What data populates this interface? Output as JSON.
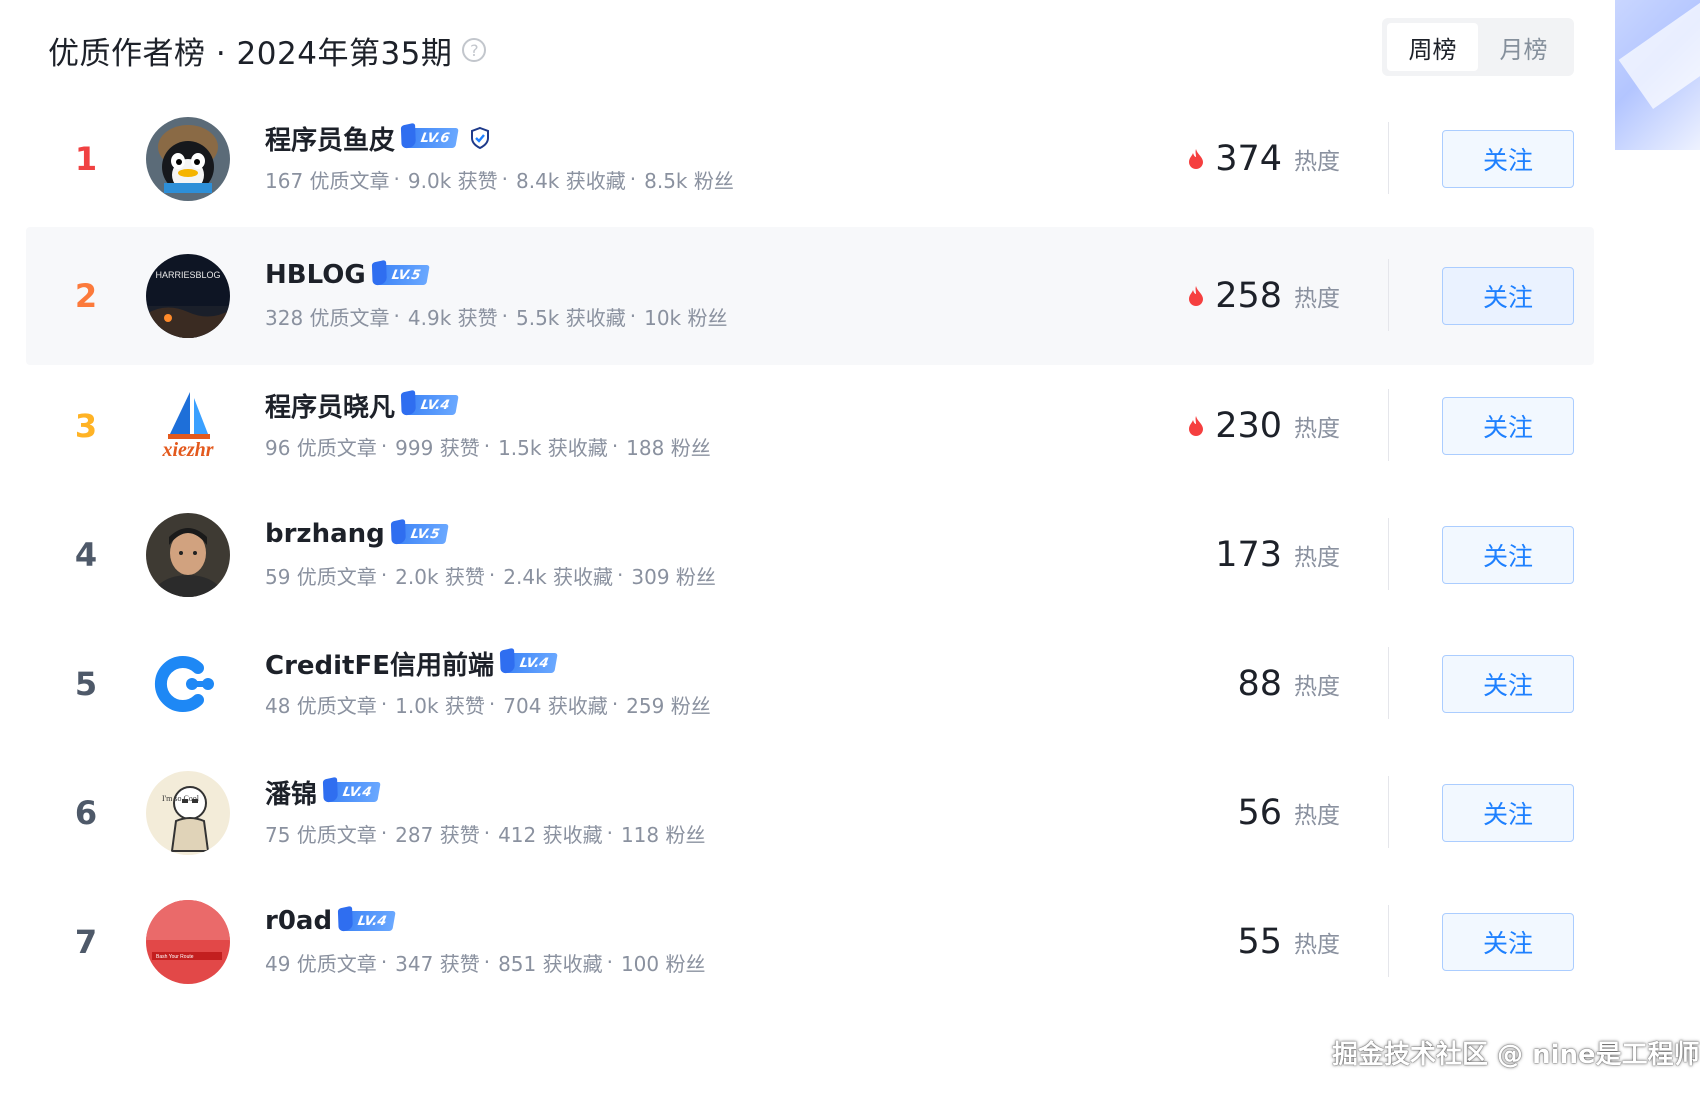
{
  "header": {
    "title": "优质作者榜 · 2024年第35期",
    "help_icon": "question-circle-icon",
    "tabs": [
      {
        "label": "周榜",
        "active": true
      },
      {
        "label": "月榜",
        "active": false
      }
    ]
  },
  "colors": {
    "rank1": "#f04142",
    "rank2": "#fc7a3b",
    "rank3": "#ffb325",
    "rank_other": "#4e5969",
    "accent": "#1e80ff",
    "flame": "#f53f3f"
  },
  "authors": [
    {
      "rank": "1",
      "name": "程序员鱼皮",
      "level": "LV.6",
      "verified": true,
      "stats": {
        "articles": "167 优质文章",
        "likes": "9.0k 获赞",
        "collects": "8.4k 获收藏",
        "fans": "8.5k 粉丝"
      },
      "heat": "374",
      "heat_label": "热度",
      "hot": true,
      "follow": "关注"
    },
    {
      "rank": "2",
      "name": "HBLOG",
      "level": "LV.5",
      "verified": false,
      "stats": {
        "articles": "328 优质文章",
        "likes": "4.9k 获赞",
        "collects": "5.5k 获收藏",
        "fans": "10k 粉丝"
      },
      "heat": "258",
      "heat_label": "热度",
      "hot": true,
      "follow": "关注",
      "avatar_text": "HARRIESBLOG"
    },
    {
      "rank": "3",
      "name": "程序员晓凡",
      "level": "LV.4",
      "verified": false,
      "stats": {
        "articles": "96 优质文章",
        "likes": "999 获赞",
        "collects": "1.5k 获收藏",
        "fans": "188 粉丝"
      },
      "heat": "230",
      "heat_label": "热度",
      "hot": true,
      "follow": "关注",
      "avatar_text": "xiezhr"
    },
    {
      "rank": "4",
      "name": "brzhang",
      "level": "LV.5",
      "verified": false,
      "stats": {
        "articles": "59 优质文章",
        "likes": "2.0k 获赞",
        "collects": "2.4k 获收藏",
        "fans": "309 粉丝"
      },
      "heat": "173",
      "heat_label": "热度",
      "hot": false,
      "follow": "关注"
    },
    {
      "rank": "5",
      "name": "CreditFE信用前端",
      "level": "LV.4",
      "verified": false,
      "stats": {
        "articles": "48 优质文章",
        "likes": "1.0k 获赞",
        "collects": "704 获收藏",
        "fans": "259 粉丝"
      },
      "heat": "88",
      "heat_label": "热度",
      "hot": false,
      "follow": "关注"
    },
    {
      "rank": "6",
      "name": "潘锦",
      "level": "LV.4",
      "verified": false,
      "stats": {
        "articles": "75 优质文章",
        "likes": "287 获赞",
        "collects": "412 获收藏",
        "fans": "118 粉丝"
      },
      "heat": "56",
      "heat_label": "热度",
      "hot": false,
      "follow": "关注",
      "avatar_text": "I'm so Cool"
    },
    {
      "rank": "7",
      "name": "r0ad",
      "level": "LV.4",
      "verified": false,
      "stats": {
        "articles": "49 优质文章",
        "likes": "347 获赞",
        "collects": "851 获收藏",
        "fans": "100 粉丝"
      },
      "heat": "55",
      "heat_label": "热度",
      "hot": false,
      "follow": "关注",
      "avatar_text": "Bash Your Route"
    }
  ],
  "watermark": "掘金技术社区 @ nine是工程师"
}
